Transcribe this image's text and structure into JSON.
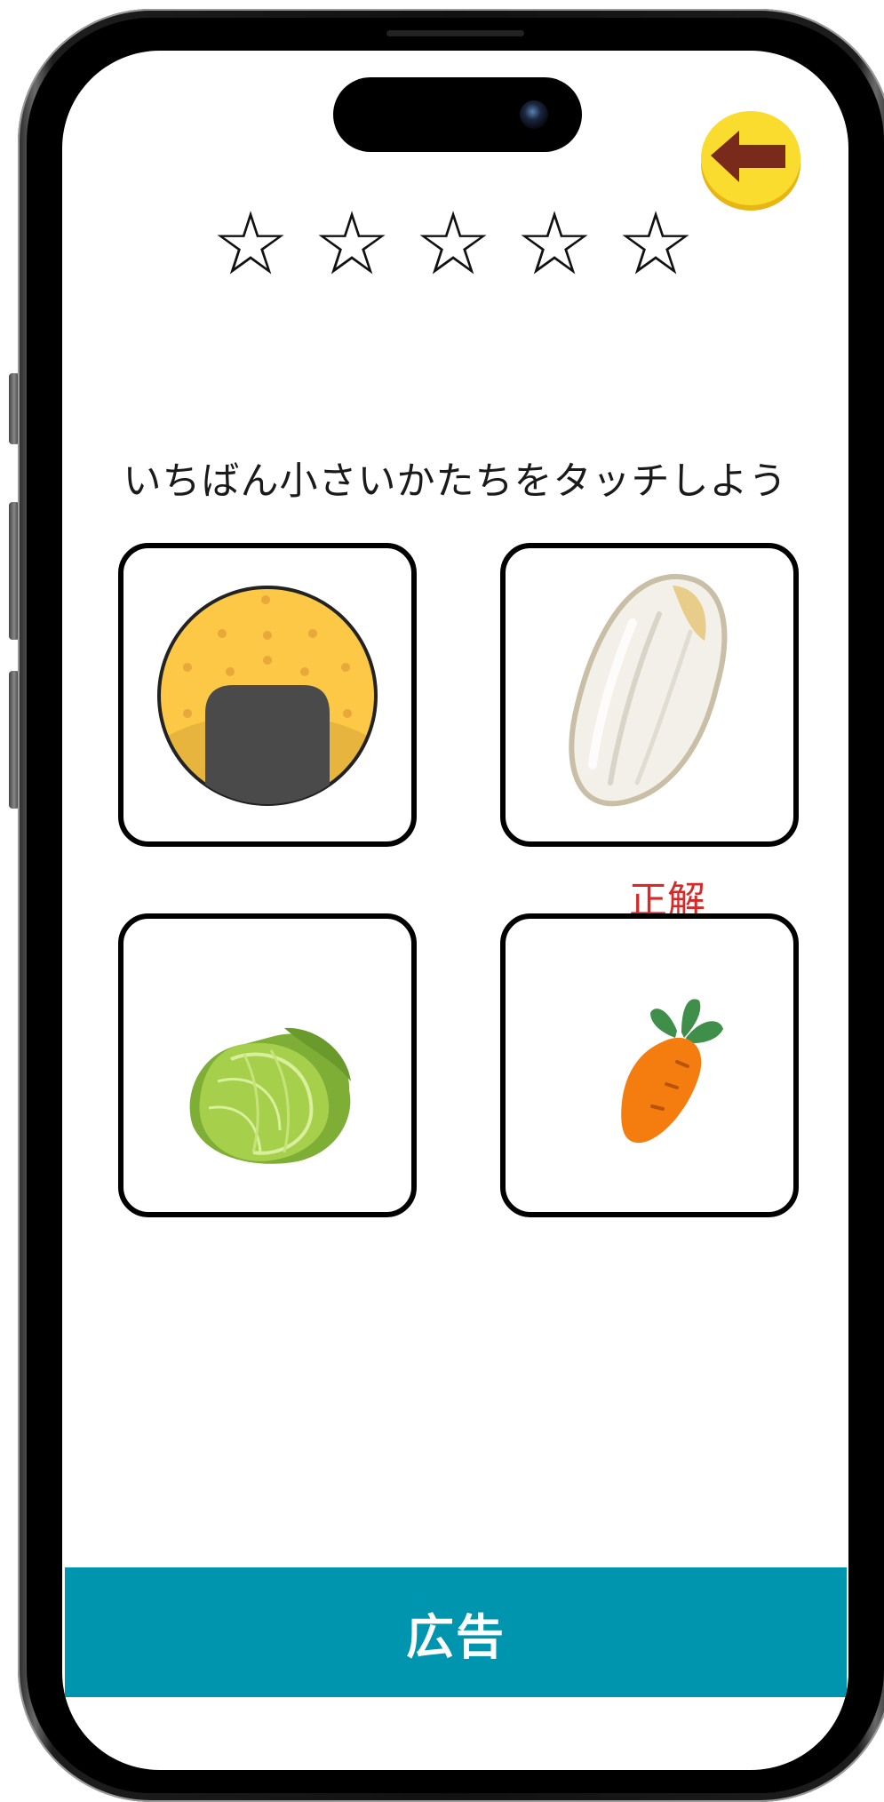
{
  "header": {
    "back_icon": "back-arrow-icon",
    "stars": [
      "☆",
      "☆",
      "☆",
      "☆",
      "☆"
    ]
  },
  "question": {
    "instruction": "いちばん小さいかたちをタッチしよう"
  },
  "choices": [
    {
      "icon": "onigiri-icon"
    },
    {
      "icon": "rice-grain-icon",
      "result_label": "正解"
    },
    {
      "icon": "cabbage-icon"
    },
    {
      "icon": "carrot-icon"
    }
  ],
  "ad": {
    "label": "広告"
  },
  "colors": {
    "accent_back_button": "#f7d51d",
    "arrow": "#7a2a1a",
    "correct_text": "#d42a2a",
    "ad_background": "#0095ae"
  }
}
